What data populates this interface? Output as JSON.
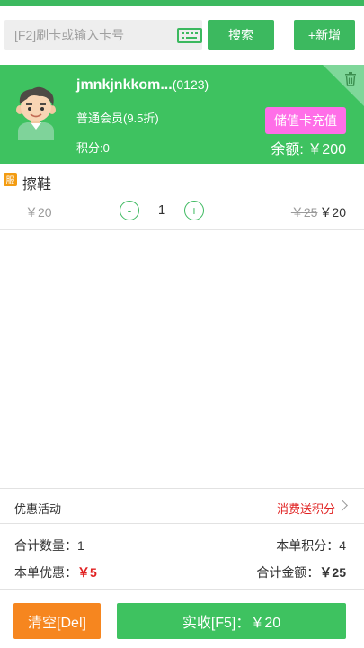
{
  "search": {
    "placeholder": "[F2]刷卡或输入卡号",
    "search_label": "搜索",
    "add_label": "+新增"
  },
  "member": {
    "name": "jmnkjnkkom...",
    "code": "(0123)",
    "level": "普通会员(9.5折)",
    "points": "积分:0",
    "recharge_label": "储值卡充值",
    "balance": "余额: ￥200"
  },
  "cart": {
    "items": [
      {
        "badge": "服",
        "name": "擦鞋",
        "unit_price": "￥20",
        "minus": "-",
        "quantity": "1",
        "plus": "+",
        "original_price": "￥25",
        "price": "￥20"
      }
    ]
  },
  "promo": {
    "label": "优惠活动",
    "value": "消费送积分"
  },
  "summary": {
    "qty_label": "合计数量：",
    "qty_value": "1",
    "points_label": "本单积分：",
    "points_value": "4",
    "discount_label": "本单优惠：",
    "discount_value": "￥5",
    "total_label": "合计金额：",
    "total_value": "￥25"
  },
  "actions": {
    "clear_label": "清空[Del]",
    "pay_label": "实收[F5]：￥20"
  },
  "colors": {
    "primary_green": "#3cb95f",
    "recharge_pink": "#ff6ee8",
    "clear_orange": "#f6861f",
    "discount_red": "#e02020"
  }
}
